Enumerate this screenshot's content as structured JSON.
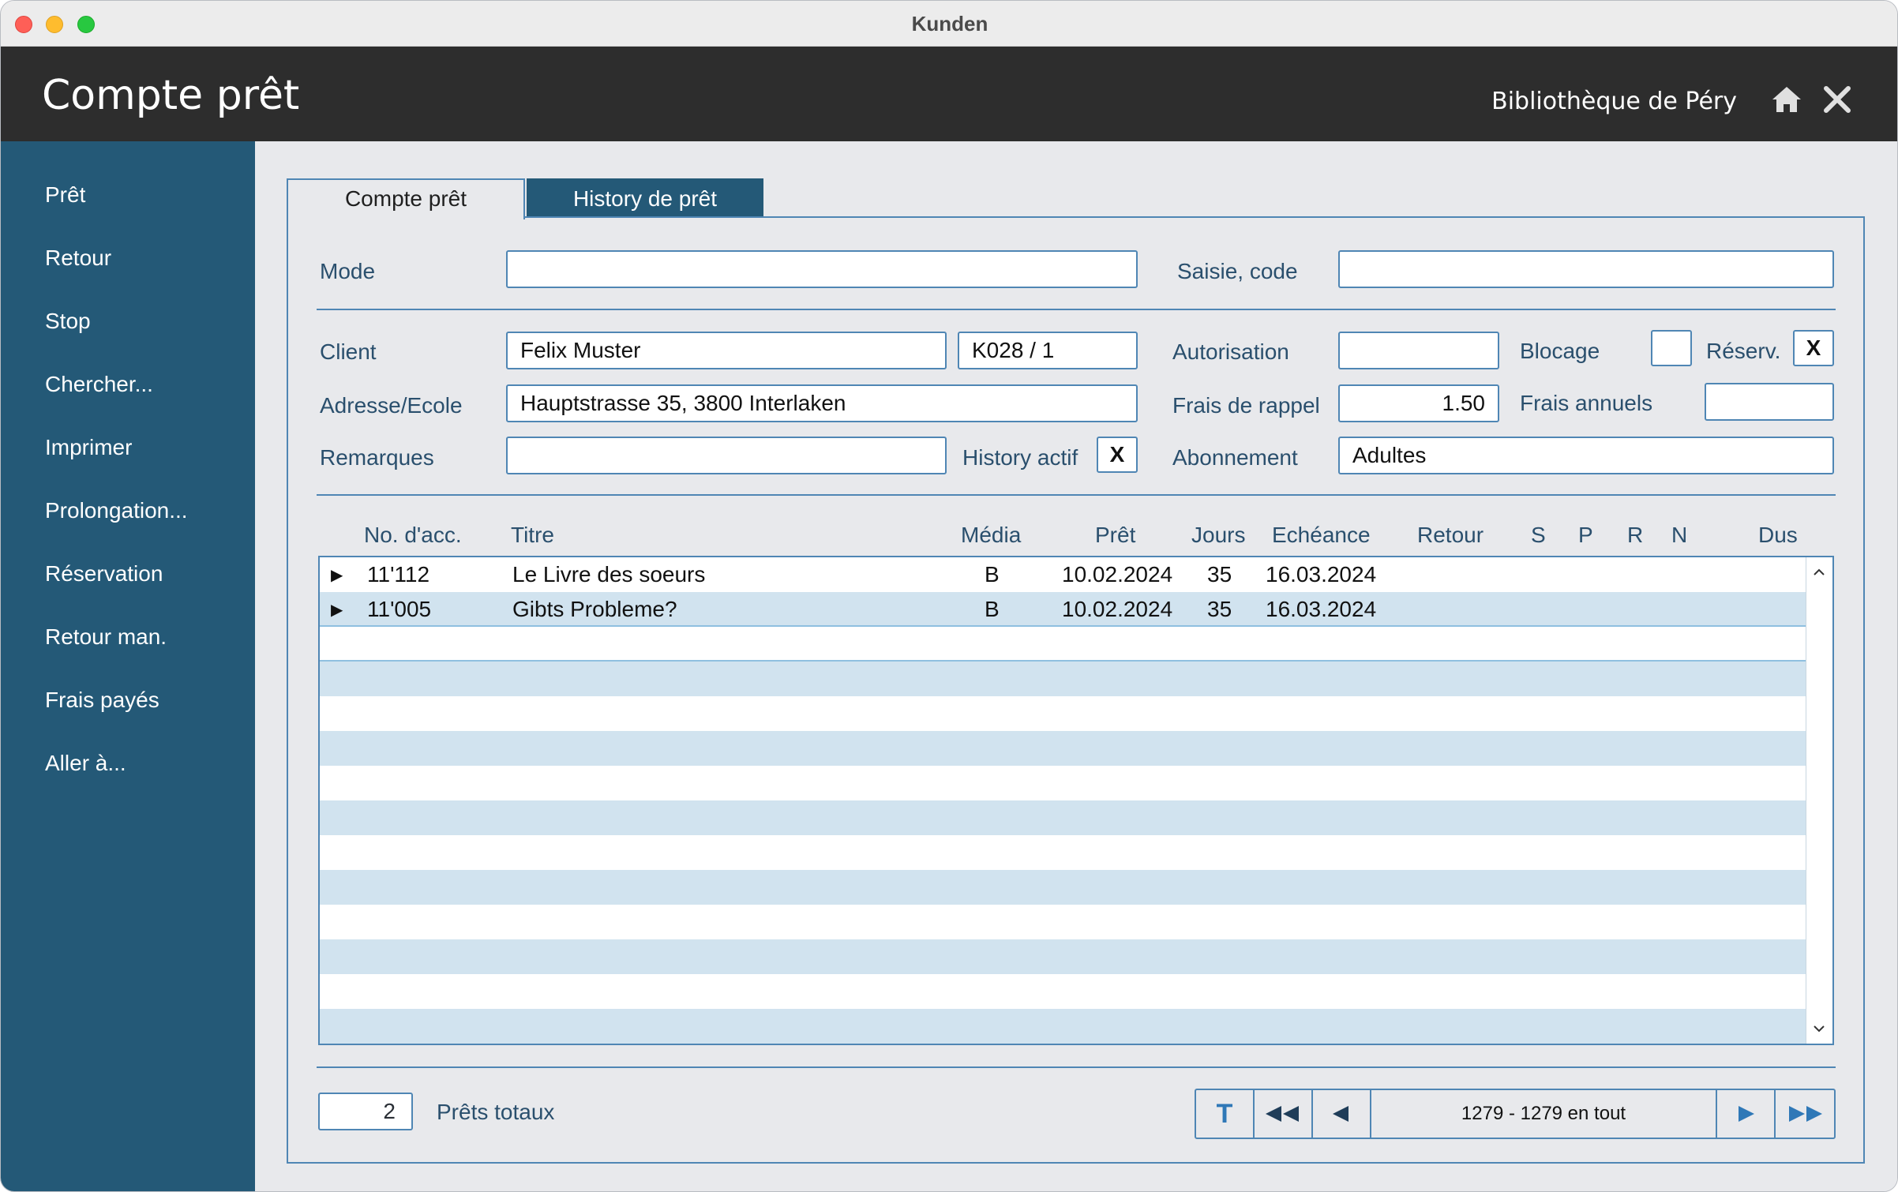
{
  "window": {
    "title": "Kunden"
  },
  "header": {
    "title": "Compte prêt",
    "library": "Bibliothèque de Péry",
    "icons": [
      "home-icon",
      "close-icon"
    ]
  },
  "sidebar": {
    "items": [
      {
        "label": "Prêt"
      },
      {
        "label": "Retour"
      },
      {
        "label": "Stop"
      },
      {
        "label": "Chercher..."
      },
      {
        "label": "Imprimer"
      },
      {
        "label": "Prolongation..."
      },
      {
        "label": "Réservation"
      },
      {
        "label": "Retour man."
      },
      {
        "label": "Frais payés"
      },
      {
        "label": "Aller à..."
      }
    ]
  },
  "tabs": [
    {
      "label": "Compte prêt",
      "active": true
    },
    {
      "label": "History de prêt",
      "active": false
    }
  ],
  "form": {
    "mode": {
      "label": "Mode",
      "value": ""
    },
    "saisie": {
      "label": "Saisie, code",
      "value": ""
    },
    "client": {
      "label": "Client",
      "name": "Felix Muster",
      "id": "K028 / 1"
    },
    "autorisation": {
      "label": "Autorisation",
      "value": ""
    },
    "blocage": {
      "label": "Blocage",
      "value": ""
    },
    "reserv": {
      "label": "Réserv.",
      "value": "X"
    },
    "adresse": {
      "label": "Adresse/Ecole",
      "value": "Hauptstrasse 35, 3800 Interlaken"
    },
    "frais_rappel": {
      "label": "Frais de rappel",
      "value": "1.50"
    },
    "frais_annuels": {
      "label": "Frais annuels",
      "value": ""
    },
    "remarques": {
      "label": "Remarques",
      "value": ""
    },
    "history_actif": {
      "label": "History actif",
      "value": "X"
    },
    "abonnement": {
      "label": "Abonnement",
      "value": "Adultes"
    }
  },
  "table": {
    "columns": [
      "No. d'acc.",
      "Titre",
      "Média",
      "Prêt",
      "Jours",
      "Echéance",
      "Retour",
      "S",
      "P",
      "R",
      "N",
      "Dus"
    ],
    "rows": [
      {
        "acc": "11'112",
        "titre": "Le Livre des soeurs",
        "media": "B",
        "pret": "10.02.2024",
        "jours": "35",
        "echeance": "16.03.2024"
      },
      {
        "acc": "11'005",
        "titre": "Gibts Probleme?",
        "media": "B",
        "pret": "10.02.2024",
        "jours": "35",
        "echeance": "16.03.2024"
      }
    ]
  },
  "footer": {
    "total_count": "2",
    "total_label": "Prêts totaux",
    "pager_info": "1279 - 1279 en tout",
    "first_label": "T"
  },
  "colors": {
    "sidebar": "#245977",
    "header": "#2d2d2d",
    "accent": "#4f86b4",
    "row_alt": "#d1e3ef"
  }
}
